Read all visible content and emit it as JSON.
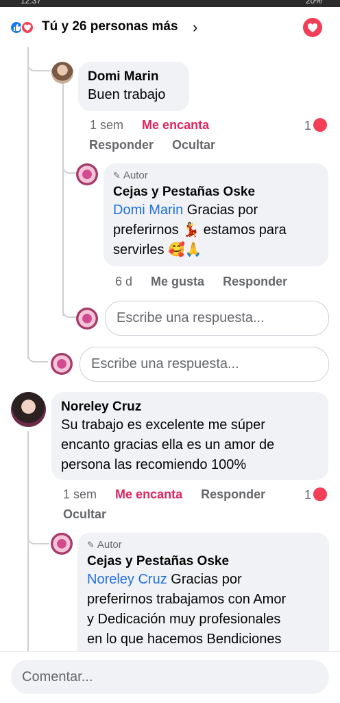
{
  "status": {
    "time": "12:37",
    "battery": "20%"
  },
  "header": {
    "reactors_text": "Tú y 26 personas más",
    "chevron": "›",
    "reaction_icons": [
      "like-icon",
      "love-icon"
    ]
  },
  "comments": [
    {
      "author": "Domi Marin",
      "text": "Buen trabajo",
      "age": "1 sem",
      "reaction_label": "Me encanta",
      "reply_label": "Responder",
      "hide_label": "Ocultar",
      "reaction_count": "1",
      "replies": [
        {
          "badge": "Autor",
          "author": "Cejas y Pestañas Oske",
          "mention": "Domi Marin",
          "text_line1": " Gracias por",
          "text_line2": "preferirnos 💃 estamos para",
          "text_line3": "servirles 🥰🙏",
          "age": "6 d",
          "like_label": "Me gusta",
          "reply_label": "Responder"
        }
      ]
    },
    {
      "author": "Noreley Cruz",
      "text_line1": "Su trabajo es excelente me súper",
      "text_line2": "encanto gracias ella es un amor de",
      "text_line3": "persona las recomiendo 100%",
      "age": "1 sem",
      "reaction_label": "Me encanta",
      "reply_label": "Responder",
      "hide_label": "Ocultar",
      "reaction_count": "1",
      "replies": [
        {
          "badge": "Autor",
          "author": "Cejas y Pestañas Oske",
          "mention": "Noreley Cruz",
          "text_line1": " Gracias por",
          "text_line2": "preferirnos trabajamos con Amor",
          "text_line3": "y Dedicación muy profesionales",
          "text_line4": "en lo que hacemos Bendiciones"
        }
      ]
    }
  ],
  "reply_placeholder": "Escribe una respuesta...",
  "comment_placeholder": "Comentar...",
  "colors": {
    "love": "#e0245e",
    "link": "#216fdb",
    "bubble": "#f0f2f5",
    "like": "#1877f2"
  }
}
